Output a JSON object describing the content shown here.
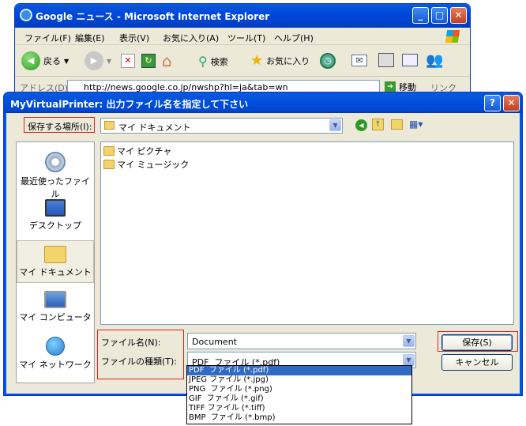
{
  "ie_window": {
    "title": "Google ニュース - Microsoft Internet Explorer",
    "menu": [
      "ファイル(F)",
      "編集(E)",
      "表示(V)",
      "お気に入り(A)",
      "ツール(T)",
      "ヘルプ(H)"
    ],
    "toolbar": {
      "back": "戻る",
      "search": "検索",
      "favorites": "お気に入り"
    },
    "address_label": "アドレス(D)",
    "address_url": "http://news.google.co.jp/nwshp?hl=ja&tab=wn",
    "go": "移動",
    "links": "リンク"
  },
  "dialog": {
    "title": "MyVirtualPrinter: 出力ファイル名を指定して下さい",
    "save_in_label": "保存する場所(I):",
    "save_in_value": "マイ ドキュメント",
    "places": [
      "最近使ったファイル",
      "デスクトップ",
      "マイ ドキュメント",
      "マイ コンピュータ",
      "マイ ネットワーク"
    ],
    "files": [
      "マイ ピクチャ",
      "マイ ミュージック"
    ],
    "filename_label": "ファイル名(N):",
    "filename_value": "Document",
    "filetype_label": "ファイルの種類(T):",
    "filetype_value": "PDF  ファイル (*.pdf)",
    "filetype_options": [
      "PDF  ファイル (*.pdf)",
      "JPEG ファイル (*.jpg)",
      "PNG  ファイル (*.png)",
      "GIF  ファイル (*.gif)",
      "TIFF ファイル (*.tiff)",
      "BMP  ファイル (*.bmp)"
    ],
    "save_button": "保存(S)",
    "cancel_button": "キャンセル"
  },
  "colors": {
    "accent": "#316ac5",
    "highlight_box": "#e02020",
    "title_bar": "#0050e0"
  }
}
